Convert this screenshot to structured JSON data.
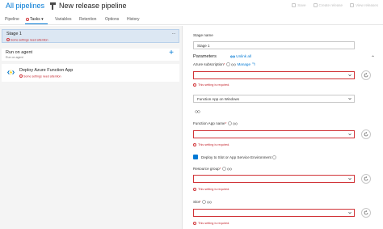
{
  "header": {
    "breadcrumb": "All pipelines",
    "separator": ">",
    "title": "New release pipeline",
    "toolbar": [
      {
        "label": "Save",
        "icon": "save-icon"
      },
      {
        "label": "Create release",
        "icon": "plus-icon"
      },
      {
        "label": "View releases",
        "icon": "list-icon"
      }
    ]
  },
  "tabs": [
    {
      "label": "Pipeline"
    },
    {
      "label": "Tasks"
    },
    {
      "label": "Variables"
    },
    {
      "label": "Retention"
    },
    {
      "label": "Options"
    },
    {
      "label": "History"
    }
  ],
  "left": {
    "stage": {
      "title": "Stage 1",
      "warning": "Some settings need attention",
      "more": "···"
    },
    "agent": {
      "title": "Run on agent",
      "subtitle": "Run on agent"
    },
    "task": {
      "title": "Deploy Azure Function App",
      "warning": "Some settings need attention"
    }
  },
  "right": {
    "stage_name_label": "Stage name",
    "stage_name_value": "Stage 1",
    "params_label": "Parameters",
    "unlink_all": "Unlink all",
    "azure_sub_label": "Azure subscription",
    "required_marker": "*",
    "manage_link": "Manage",
    "required_msg": "This setting is required.",
    "app_type_value": "Function App on Windows",
    "function_app_label": "Function App name",
    "deploy_slot_label": "Deploy to Slot or App Service Environment",
    "resource_group_label": "Resource group",
    "slot_label": "Slot"
  },
  "colors": {
    "accent": "#0078d4",
    "error": "#d13438",
    "stage_bg": "#dce7f3"
  }
}
